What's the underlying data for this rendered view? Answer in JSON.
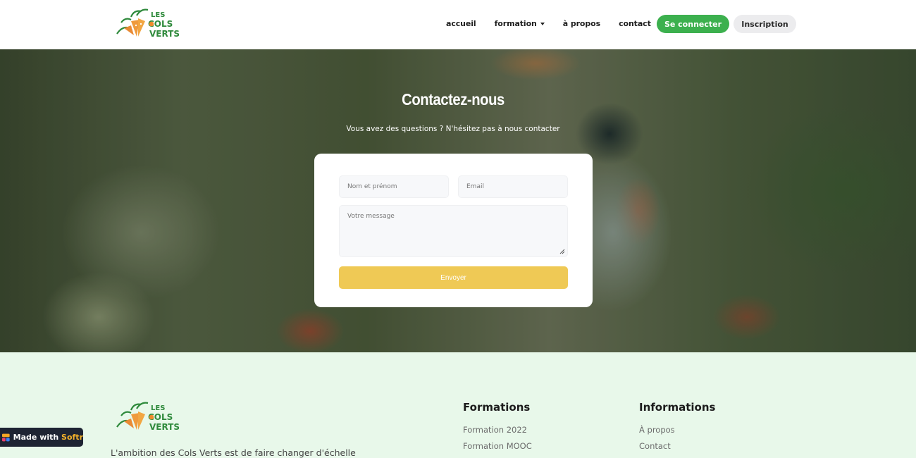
{
  "brand": {
    "name": "Les Cols Verts",
    "logo_line1": "LES",
    "logo_line2": "COLS",
    "logo_line3": "VERTS"
  },
  "nav": {
    "links": [
      {
        "label": "accueil"
      },
      {
        "label": "formation",
        "has_dropdown": true
      },
      {
        "label": "à propos"
      },
      {
        "label": "contact"
      }
    ],
    "login_label": "Se connecter",
    "signup_label": "Inscription"
  },
  "hero": {
    "title": "Contactez-nous",
    "subtitle": "Vous avez des questions ? N'hésitez pas à nous contacter"
  },
  "form": {
    "name_placeholder": "Nom et prénom",
    "name_value": "",
    "email_placeholder": "Email",
    "email_value": "",
    "message_placeholder": "Votre message",
    "message_value": "",
    "submit_label": "Envoyer"
  },
  "footer": {
    "description": "L'ambition des Cols Verts est de faire changer d'échelle",
    "columns": [
      {
        "title": "Formations",
        "links": [
          "Formation 2022",
          "Formation MOOC"
        ]
      },
      {
        "title": "Informations",
        "links": [
          "À propos",
          "Contact"
        ]
      }
    ]
  },
  "badge": {
    "prefix": "Made with ",
    "brand": "Softr"
  },
  "colors": {
    "primary_green": "#3cb04e",
    "submit_yellow": "#efc955",
    "footer_bg": "#e8f8ea",
    "badge_bg": "#1e2433",
    "badge_accent": "#f3b12a"
  }
}
